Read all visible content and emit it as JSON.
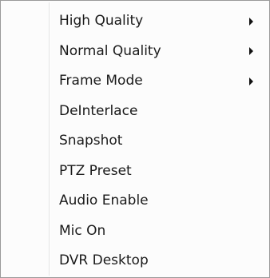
{
  "menu": {
    "items": [
      {
        "label": "High Quality",
        "has_submenu": true
      },
      {
        "label": "Normal Quality",
        "has_submenu": true
      },
      {
        "label": "Frame Mode",
        "has_submenu": true
      },
      {
        "label": "DeInterlace",
        "has_submenu": false
      },
      {
        "label": "Snapshot",
        "has_submenu": false
      },
      {
        "label": "PTZ Preset",
        "has_submenu": false
      },
      {
        "label": "Audio Enable",
        "has_submenu": false
      },
      {
        "label": "Mic On",
        "has_submenu": false
      },
      {
        "label": "DVR Desktop",
        "has_submenu": false
      }
    ]
  }
}
